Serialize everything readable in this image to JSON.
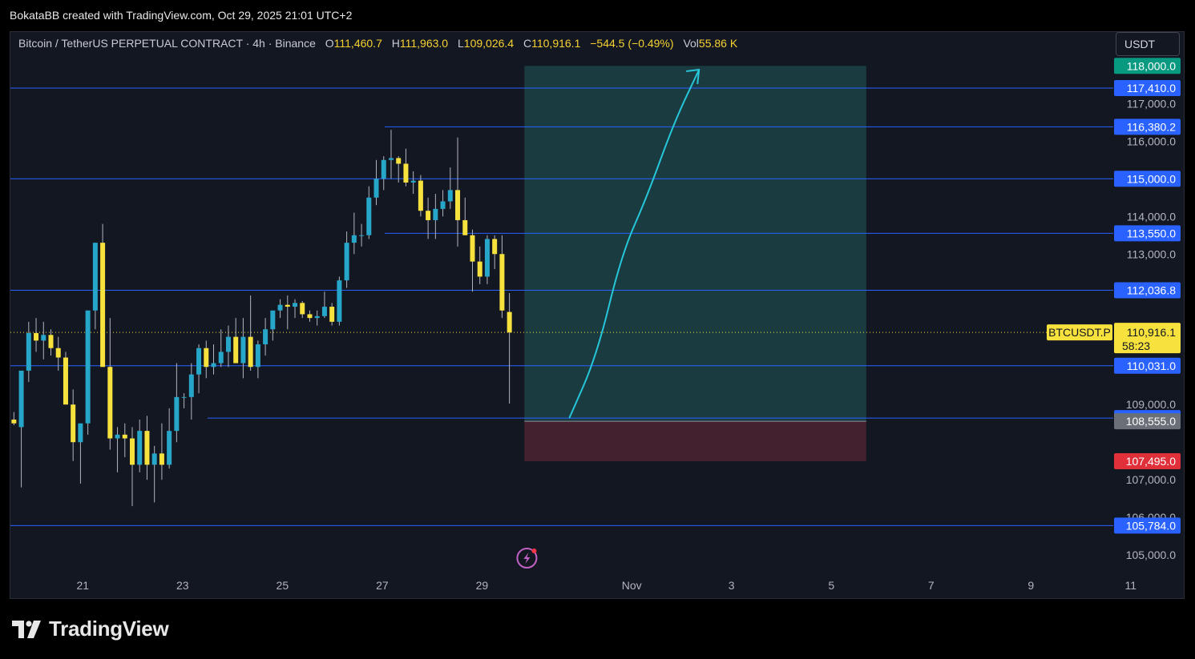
{
  "credit": "BokataBB created with TradingView.com, Oct 29, 2025 21:01 UTC+2",
  "symbol": {
    "name": "Bitcoin / TetherUS PERPETUAL CONTRACT · 4h · Binance",
    "open_label": "O",
    "open": "111,460.7",
    "high_label": "H",
    "high": "111,963.0",
    "low_label": "L",
    "low": "109,026.4",
    "close_label": "C",
    "close": "110,916.1",
    "change": "−544.5 (−0.49%)",
    "vol_label": "Vol",
    "vol": "55.86 K"
  },
  "currency_button": "USDT",
  "logo_text": "TradingView",
  "colors": {
    "background": "#131722",
    "up_candle": "#26a6c8",
    "down_candle": "#f7e13d",
    "horizontal_line": "#2962ff",
    "target_zone": "#1e4d4d",
    "stop_zone": "#4a2231",
    "arrow": "#26c6da",
    "price_tag_current": "#f7e13d",
    "stop_tag": "#e0303a",
    "entry_tag": "#6b6f78",
    "target_tag": "#089981"
  },
  "chart_data": {
    "type": "candlestick",
    "timeframe": "4h",
    "ylim": [
      104600,
      118900
    ],
    "x_range_days": [
      19.55,
      41.65
    ],
    "x_ticks": [
      {
        "day": 21,
        "label": "21"
      },
      {
        "day": 23,
        "label": "23"
      },
      {
        "day": 25,
        "label": "25"
      },
      {
        "day": 27,
        "label": "27"
      },
      {
        "day": 29,
        "label": "29"
      },
      {
        "day": 32,
        "label": "Nov"
      },
      {
        "day": 34,
        "label": "3"
      },
      {
        "day": 36,
        "label": "5"
      },
      {
        "day": 38,
        "label": "7"
      },
      {
        "day": 40,
        "label": "9"
      },
      {
        "day": 42,
        "label": "11"
      }
    ],
    "y_ticks": [
      {
        "value": 117000,
        "label": "117,000.0"
      },
      {
        "value": 116000,
        "label": "116,000.0"
      },
      {
        "value": 114000,
        "label": "114,000.0"
      },
      {
        "value": 113000,
        "label": "113,000.0"
      },
      {
        "value": 109000,
        "label": "109,000.0"
      },
      {
        "value": 107000,
        "label": "107,000.0"
      },
      {
        "value": 106000,
        "label": "106,000.0"
      },
      {
        "value": 105000,
        "label": "105,000.0"
      }
    ],
    "candles": [
      {
        "o": 108600,
        "h": 108800,
        "l": 108450,
        "c": 108500
      },
      {
        "o": 108400,
        "h": 109800,
        "l": 106800,
        "c": 109900
      },
      {
        "o": 109900,
        "h": 111200,
        "l": 109600,
        "c": 110900
      },
      {
        "o": 110900,
        "h": 111300,
        "l": 110400,
        "c": 110700
      },
      {
        "o": 110700,
        "h": 111200,
        "l": 110200,
        "c": 110850
      },
      {
        "o": 110850,
        "h": 111000,
        "l": 110300,
        "c": 110500
      },
      {
        "o": 110500,
        "h": 110800,
        "l": 109900,
        "c": 110250
      },
      {
        "o": 110250,
        "h": 110400,
        "l": 109200,
        "c": 109000
      },
      {
        "o": 109000,
        "h": 109400,
        "l": 107500,
        "c": 108000
      },
      {
        "o": 108000,
        "h": 108300,
        "l": 106900,
        "c": 108500
      },
      {
        "o": 108500,
        "h": 111500,
        "l": 108200,
        "c": 111500
      },
      {
        "o": 111500,
        "h": 113300,
        "l": 111000,
        "c": 113300
      },
      {
        "o": 113300,
        "h": 113800,
        "l": 110000,
        "c": 110000
      },
      {
        "o": 110000,
        "h": 111300,
        "l": 107800,
        "c": 108100
      },
      {
        "o": 108100,
        "h": 108400,
        "l": 107200,
        "c": 108200
      },
      {
        "o": 108200,
        "h": 108500,
        "l": 107600,
        "c": 108100
      },
      {
        "o": 108100,
        "h": 108400,
        "l": 106300,
        "c": 107400
      },
      {
        "o": 107400,
        "h": 108600,
        "l": 107200,
        "c": 108300
      },
      {
        "o": 108300,
        "h": 108700,
        "l": 107000,
        "c": 107400
      },
      {
        "o": 107400,
        "h": 107900,
        "l": 106400,
        "c": 107700
      },
      {
        "o": 107700,
        "h": 108500,
        "l": 107000,
        "c": 107400
      },
      {
        "o": 107400,
        "h": 108900,
        "l": 107300,
        "c": 108300
      },
      {
        "o": 108300,
        "h": 110100,
        "l": 108000,
        "c": 109200
      },
      {
        "o": 109200,
        "h": 109300,
        "l": 108900,
        "c": 109200
      },
      {
        "o": 109200,
        "h": 110100,
        "l": 108600,
        "c": 109800
      },
      {
        "o": 109800,
        "h": 110600,
        "l": 109300,
        "c": 110500
      },
      {
        "o": 110500,
        "h": 110700,
        "l": 109700,
        "c": 110000
      },
      {
        "o": 110000,
        "h": 110600,
        "l": 109800,
        "c": 110100
      },
      {
        "o": 110100,
        "h": 111000,
        "l": 110000,
        "c": 110400
      },
      {
        "o": 110400,
        "h": 111100,
        "l": 110000,
        "c": 110800
      },
      {
        "o": 110800,
        "h": 111300,
        "l": 110100,
        "c": 110100
      },
      {
        "o": 110100,
        "h": 111300,
        "l": 109700,
        "c": 110800
      },
      {
        "o": 110800,
        "h": 111900,
        "l": 109900,
        "c": 110000
      },
      {
        "o": 110000,
        "h": 110700,
        "l": 109700,
        "c": 110600
      },
      {
        "o": 110600,
        "h": 111300,
        "l": 110300,
        "c": 111000
      },
      {
        "o": 111000,
        "h": 111400,
        "l": 110700,
        "c": 111500
      },
      {
        "o": 111500,
        "h": 111800,
        "l": 111300,
        "c": 111650
      },
      {
        "o": 111650,
        "h": 111900,
        "l": 111000,
        "c": 111600
      },
      {
        "o": 111600,
        "h": 111800,
        "l": 111300,
        "c": 111700
      },
      {
        "o": 111700,
        "h": 111750,
        "l": 111300,
        "c": 111400
      },
      {
        "o": 111400,
        "h": 111500,
        "l": 111200,
        "c": 111300
      },
      {
        "o": 111300,
        "h": 111500,
        "l": 111100,
        "c": 111350
      },
      {
        "o": 111350,
        "h": 112000,
        "l": 111300,
        "c": 111600
      },
      {
        "o": 111600,
        "h": 111700,
        "l": 111100,
        "c": 111200
      },
      {
        "o": 111200,
        "h": 112400,
        "l": 111100,
        "c": 112300
      },
      {
        "o": 112300,
        "h": 113600,
        "l": 112100,
        "c": 113300
      },
      {
        "o": 113300,
        "h": 114100,
        "l": 113000,
        "c": 113500
      },
      {
        "o": 113500,
        "h": 113800,
        "l": 113200,
        "c": 113500
      },
      {
        "o": 113500,
        "h": 114800,
        "l": 113400,
        "c": 114500
      },
      {
        "o": 114500,
        "h": 115500,
        "l": 114300,
        "c": 115000
      },
      {
        "o": 115000,
        "h": 115600,
        "l": 114700,
        "c": 115500
      },
      {
        "o": 115500,
        "h": 116300,
        "l": 115000,
        "c": 115550
      },
      {
        "o": 115550,
        "h": 115600,
        "l": 114900,
        "c": 115400
      },
      {
        "o": 115400,
        "h": 115800,
        "l": 114800,
        "c": 114900
      },
      {
        "o": 114900,
        "h": 115200,
        "l": 114600,
        "c": 114950
      },
      {
        "o": 114950,
        "h": 115100,
        "l": 114000,
        "c": 114150
      },
      {
        "o": 114150,
        "h": 114500,
        "l": 113400,
        "c": 113900
      },
      {
        "o": 113900,
        "h": 114600,
        "l": 113400,
        "c": 114200
      },
      {
        "o": 114200,
        "h": 114700,
        "l": 114000,
        "c": 114400
      },
      {
        "o": 114400,
        "h": 115300,
        "l": 114200,
        "c": 114700
      },
      {
        "o": 114700,
        "h": 116100,
        "l": 113200,
        "c": 113900
      },
      {
        "o": 113900,
        "h": 114500,
        "l": 113500,
        "c": 113500
      },
      {
        "o": 113500,
        "h": 113650,
        "l": 112000,
        "c": 112800
      },
      {
        "o": 112800,
        "h": 113200,
        "l": 112200,
        "c": 112400
      },
      {
        "o": 112400,
        "h": 113500,
        "l": 112200,
        "c": 113400
      },
      {
        "o": 113400,
        "h": 113500,
        "l": 112600,
        "c": 113000
      },
      {
        "o": 113000,
        "h": 113500,
        "l": 111300,
        "c": 111500
      },
      {
        "o": 111460.7,
        "h": 111963.0,
        "l": 109026.4,
        "c": 110916.1
      }
    ],
    "horizontal_levels": [
      {
        "value": 117410.0,
        "label": "117,410.0",
        "x_start_day": 19.55
      },
      {
        "value": 116380.2,
        "label": "116,380.2",
        "x_start_day": 27.05
      },
      {
        "value": 115000.0,
        "label": "115,000.0",
        "x_start_day": 19.55
      },
      {
        "value": 113550.0,
        "label": "113,550.0",
        "x_start_day": 27.05
      },
      {
        "value": 112036.8,
        "label": "112,036.8",
        "x_start_day": 19.55
      },
      {
        "value": 110031.0,
        "label": "110,031.0",
        "x_start_day": 19.55
      },
      {
        "value": 108639.4,
        "label": "108,639.4",
        "x_start_day": 23.5
      },
      {
        "value": 105784.0,
        "label": "105,784.0",
        "x_start_day": 19.55
      }
    ],
    "current_price": {
      "value": 110916.1,
      "label": "110,916.1",
      "countdown": "58:23",
      "symbol_tag": "BTCUSDT.P"
    },
    "position": {
      "x_start_day": 29.85,
      "x_end_day": 36.7,
      "target": {
        "value": 118000.0,
        "label": "118,000.0"
      },
      "entry": {
        "value": 108555.0,
        "label": "108,555.0"
      },
      "stop": {
        "value": 107495.0,
        "label": "107,495.0"
      }
    },
    "arrow_path": [
      {
        "day": 30.75,
        "price": 108640
      },
      {
        "day": 31.3,
        "price": 110300
      },
      {
        "day": 31.8,
        "price": 113000
      },
      {
        "day": 32.3,
        "price": 114500
      },
      {
        "day": 32.85,
        "price": 116500
      },
      {
        "day": 33.35,
        "price": 117900
      }
    ]
  }
}
